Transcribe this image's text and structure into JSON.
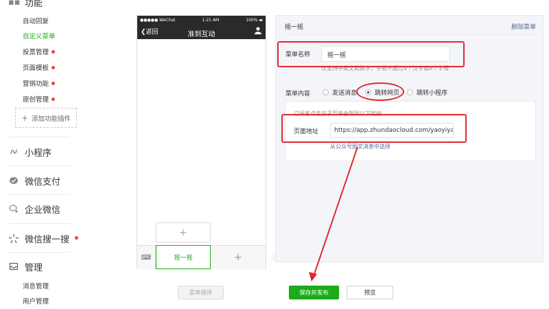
{
  "sidebar": {
    "function_header": "功能",
    "function_items": [
      {
        "label": "自动回复",
        "active": false,
        "dot": false
      },
      {
        "label": "自定义菜单",
        "active": true,
        "dot": false
      },
      {
        "label": "投票管理",
        "active": false,
        "dot": true
      },
      {
        "label": "页面模板",
        "active": false,
        "dot": true
      },
      {
        "label": "营销功能",
        "active": false,
        "dot": true
      },
      {
        "label": "原创管理",
        "active": false,
        "dot": true
      }
    ],
    "add_plugin": "添加功能插件",
    "miniprogram": "小程序",
    "wechat_pay": "微信支付",
    "work_wechat": "企业微信",
    "wechat_search": "微信搜一搜",
    "manage": "管理",
    "manage_items": [
      "消息管理",
      "用户管理"
    ]
  },
  "phone": {
    "carrier": "●●●●● WeChat",
    "time": "1:21 AM",
    "battery": "100%",
    "back": "返回",
    "title": "准到互动",
    "sub_add": "+",
    "menu_item_1": "摇一摇",
    "menu_item_2": "+"
  },
  "panel": {
    "title": "摇一摇",
    "delete": "删除菜单",
    "name_label": "菜单名称",
    "name_value": "摇一摇",
    "name_tip": "仅支持中英文和数字，字数不超过4个汉字或8个字母",
    "content_label": "菜单内容",
    "options": [
      "发送消息",
      "跳转网页",
      "跳转小程序"
    ],
    "selected_option": "跳转网页",
    "url_tip": "订阅者点击该子菜单会跳到以下链接",
    "url_label": "页面地址",
    "url_value": "https://app.zhundaocloud.com/yaoyiyao",
    "url_link": "从公众号图文消息中选择"
  },
  "buttons": {
    "sort": "菜单排序",
    "save": "保存并发布",
    "preview": "预览"
  },
  "colors": {
    "accent": "#1aad19",
    "annotation": "#e0282e",
    "link": "#576b95"
  }
}
